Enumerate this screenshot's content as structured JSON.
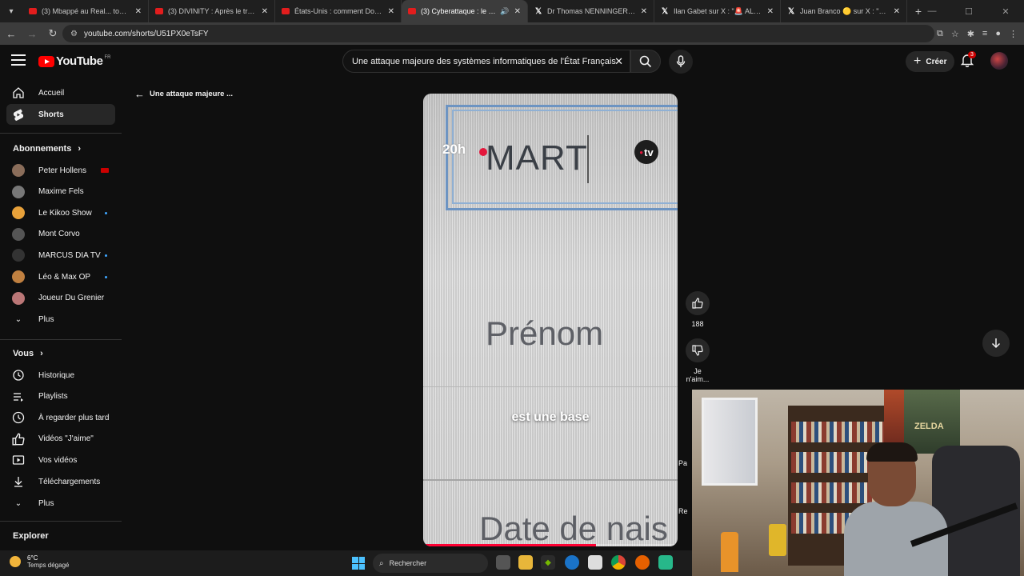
{
  "browser": {
    "tabs": [
      {
        "title": "(3) Mbappé au Real... touché pa",
        "favicon": "youtube-icon",
        "active": false
      },
      {
        "title": "(3) DIVINITY : Après le trailer, L",
        "favicon": "youtube-icon",
        "active": false
      },
      {
        "title": "États-Unis : comment Donald T",
        "favicon": "youtube-icon",
        "active": false
      },
      {
        "title": "(3) Cyberattaque : le ministè",
        "favicon": "youtube-icon",
        "active": true
      },
      {
        "title": "Dr Thomas NENNINGER sur X :",
        "favicon": "x-icon",
        "active": false
      },
      {
        "title": "Ilan Gabet sur X : \"🚨 ALERTE l",
        "favicon": "x-icon",
        "active": false
      },
      {
        "title": "Juan Branco 🟡 sur X : \"Une att",
        "favicon": "x-icon",
        "active": false
      }
    ],
    "url": "youtube.com/shorts/U51PX0eTsFY"
  },
  "youtube": {
    "logo_text": "YouTube",
    "country": "FR",
    "search_value": "Une attaque majeure des systèmes informatiques de l'État Français",
    "create_label": "Créer",
    "notif_count": "3"
  },
  "sidebar": {
    "main": [
      {
        "label": "Accueil",
        "icon": "home-icon"
      },
      {
        "label": "Shorts",
        "icon": "shorts-icon"
      }
    ],
    "subs_heading": "Abonnements",
    "subs": [
      {
        "label": "Peter Hollens",
        "badge": "live",
        "color": "#8a6d5a"
      },
      {
        "label": "Maxime Fels",
        "badge": "",
        "color": "#777"
      },
      {
        "label": "Le Kikoo Show",
        "badge": "new",
        "color": "#e8a13a"
      },
      {
        "label": "Mont Corvo",
        "badge": "",
        "color": "#555"
      },
      {
        "label": "MARCUS DIA TV",
        "badge": "new",
        "color": "#333"
      },
      {
        "label": "Léo & Max OP",
        "badge": "new",
        "color": "#c08040"
      },
      {
        "label": "Joueur Du Grenier",
        "badge": "",
        "color": "#b77"
      }
    ],
    "subs_more": "Plus",
    "you_heading": "Vous",
    "you": [
      {
        "label": "Historique",
        "icon": "history-icon"
      },
      {
        "label": "Playlists",
        "icon": "playlists-icon"
      },
      {
        "label": "À regarder plus tard",
        "icon": "watch-later-icon"
      },
      {
        "label": "Vidéos \"J'aime\"",
        "icon": "thumbs-up-icon"
      },
      {
        "label": "Vos vidéos",
        "icon": "your-videos-icon"
      },
      {
        "label": "Téléchargements",
        "icon": "download-icon"
      }
    ],
    "you_more": "Plus",
    "explore_heading": "Explorer"
  },
  "short": {
    "back_title": "Une attaque majeure ...",
    "overlay_20h": "20h",
    "overlay_text": "MART",
    "overlay_tv": "tv",
    "field_prenom": "Prénom",
    "caption": "est une base",
    "field_date": "Date de nais",
    "progress": 0.68,
    "likes": "188",
    "dislike_label": "Je n'aim...",
    "share_label": "Pa",
    "remix_label": "Re"
  },
  "taskbar": {
    "temp": "6°C",
    "weather": "Temps dégagé",
    "search_placeholder": "Rechercher"
  }
}
